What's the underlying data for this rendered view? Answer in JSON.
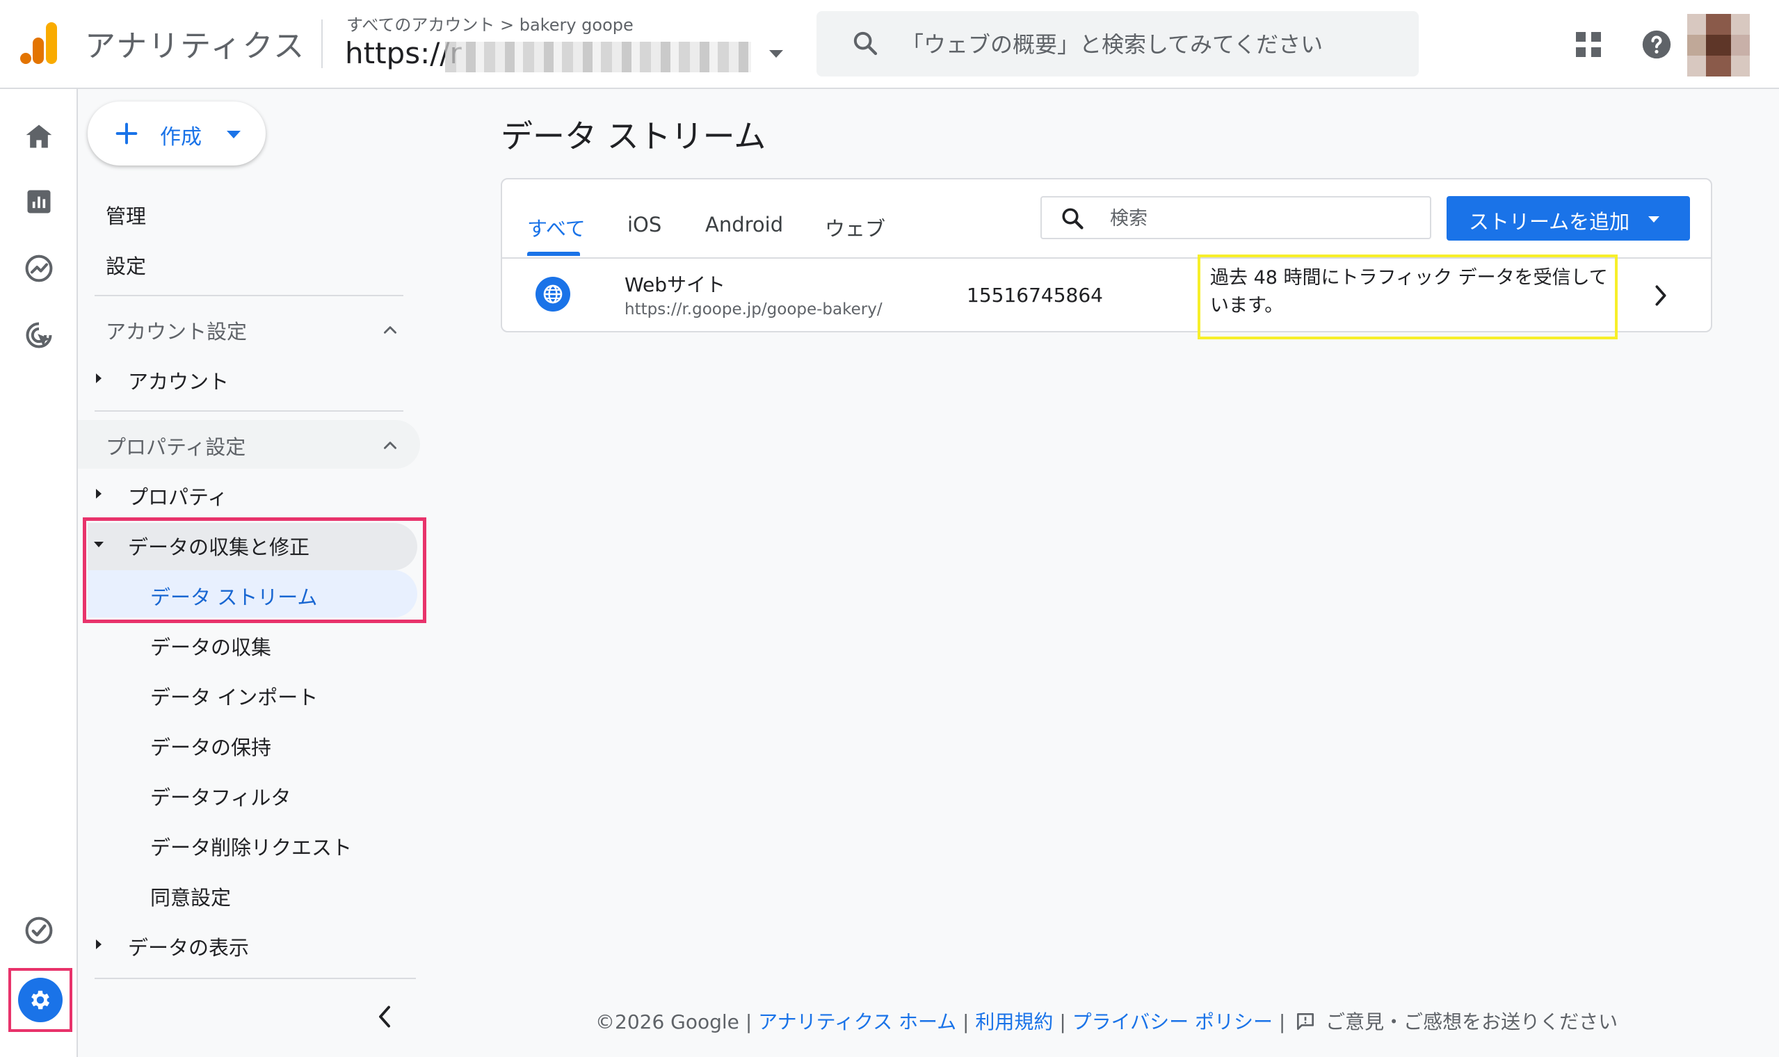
{
  "header": {
    "app_title": "アナリティクス",
    "breadcrumb": "すべてのアカウント > bakery goope",
    "property_url": "https://r",
    "search_placeholder": "「ウェブの概要」と検索してみてください"
  },
  "sidenav": {
    "create_label": "作成",
    "admin": "管理",
    "settings": "設定",
    "account_section": "アカウント設定",
    "account": "アカウント",
    "property_section": "プロパティ設定",
    "property": "プロパティ",
    "data_collection_modify": "データの収集と修正",
    "data_streams": "データ ストリーム",
    "data_collection": "データの収集",
    "data_import": "データ インポート",
    "data_retention": "データの保持",
    "data_filter": "データフィルタ",
    "data_deletion": "データ削除リクエスト",
    "consent": "同意設定",
    "data_display": "データの表示"
  },
  "main": {
    "title": "データ ストリーム",
    "tabs": [
      {
        "label": "すべて"
      },
      {
        "label": "iOS"
      },
      {
        "label": "Android"
      },
      {
        "label": "ウェブ"
      }
    ],
    "search_placeholder": "検索",
    "add_stream_label": "ストリームを追加",
    "stream": {
      "name": "Webサイト",
      "url": "https://r.goope.jp/goope-bakery/",
      "id": "15516745864",
      "status": "過去 48 時間にトラフィック データを受信しています。"
    }
  },
  "footer": {
    "copyright": "©2026 Google",
    "sep": "|",
    "home": "アナリティクス ホーム",
    "terms": "利用規約",
    "privacy": "プライバシー ポリシー",
    "feedback": "ご意見・ご感想をお送りください"
  },
  "colors": {
    "accent": "#1a73e8",
    "highlight_pink": "#e8336b",
    "highlight_yellow": "#f7ef2a",
    "logo_orange": "#f9ab00",
    "logo_dark_orange": "#e37400"
  }
}
